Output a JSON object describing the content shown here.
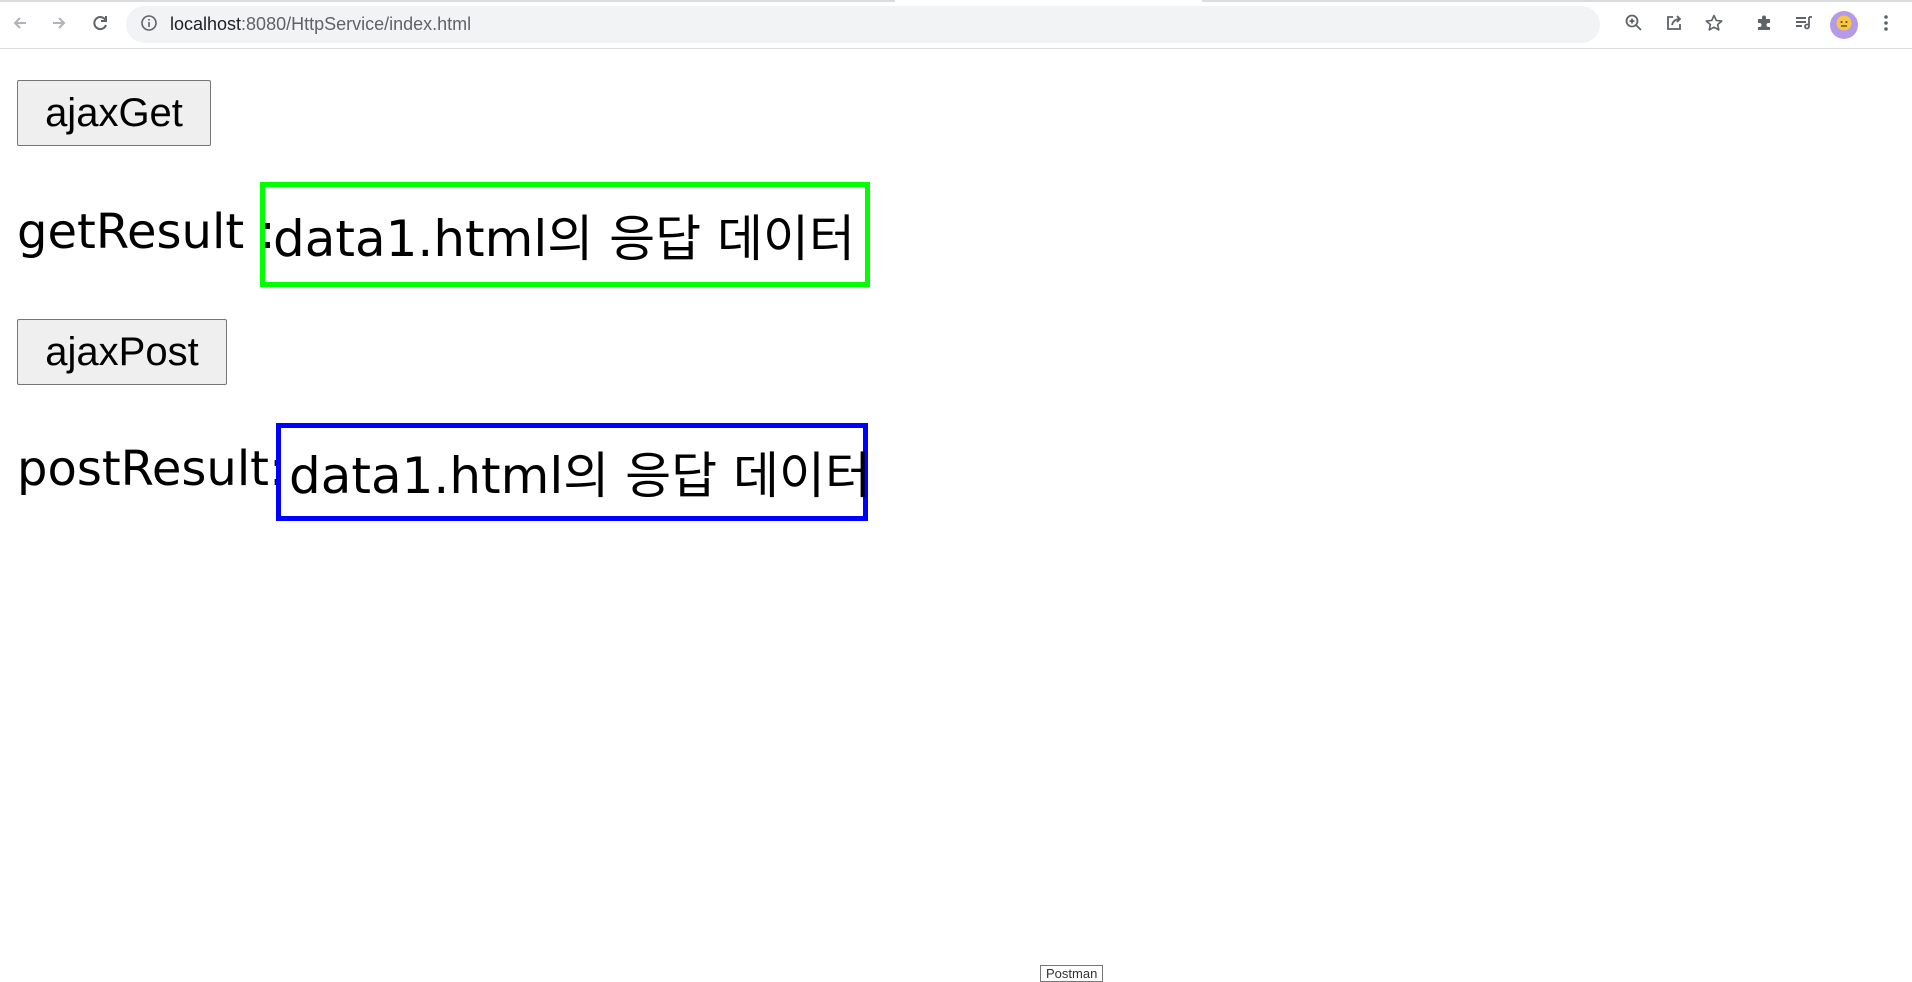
{
  "browser": {
    "url_host": "localhost",
    "url_rest": ":8080/HttpService/index.html",
    "icons": {
      "back": "arrow-left-icon",
      "forward": "arrow-right-icon",
      "reload": "reload-icon",
      "site_info": "info-icon",
      "zoom": "zoom-icon",
      "share": "share-icon",
      "bookmark": "star-icon",
      "extensions": "puzzle-icon",
      "reading_list": "reading-list-icon",
      "menu": "kebab-menu-icon"
    }
  },
  "page": {
    "get_button_label": "ajaxGet",
    "get_result_label": "getResult :",
    "get_result_value": "data1.html의 응답 데이터",
    "post_button_label": "ajaxPost",
    "post_result_label": "postResult:",
    "post_result_value": "data1.html의 응답 데이터"
  },
  "tooltip": {
    "text": "Postman"
  },
  "colors": {
    "get_result_border": "#00ff00",
    "post_result_border": "#0000ff",
    "button_bg": "#efefef",
    "omnibox_bg": "#f1f3f4"
  }
}
